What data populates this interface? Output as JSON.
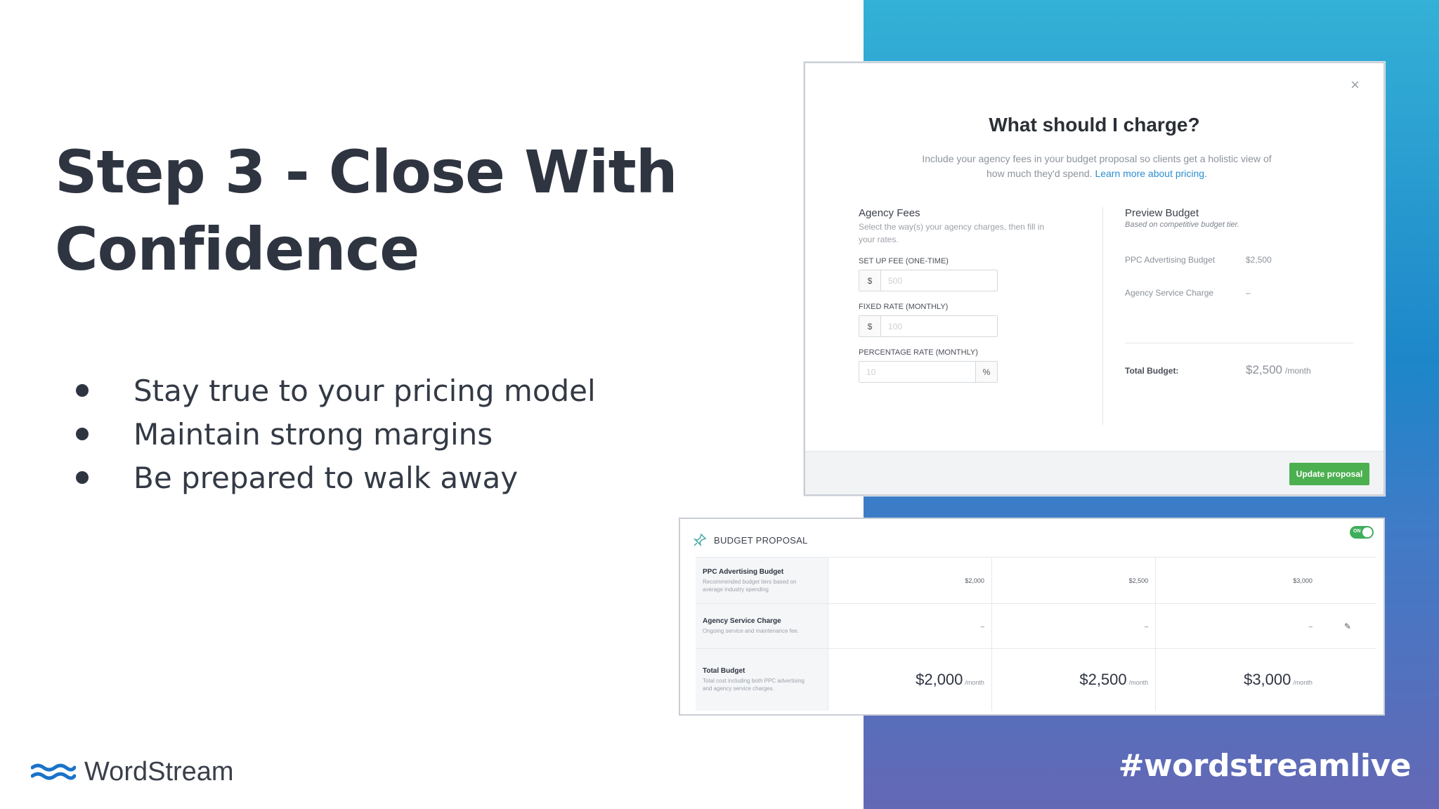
{
  "slide": {
    "title_line1": "Step 3 - Close With",
    "title_line2": "Confidence",
    "bullets": [
      "Stay true to your pricing model",
      "Maintain strong margins",
      "Be prepared to walk away"
    ],
    "brand_name": "WordStream",
    "hashtag": "#wordstreamlive",
    "colors": {
      "accent_gradient_top": "#34b1d6",
      "accent_gradient_bottom": "#6468b5",
      "brand_blue": "#1a73c8",
      "button_green": "#4caf50"
    }
  },
  "modal": {
    "close_icon": "×",
    "title": "What should I charge?",
    "subtitle": "Include your agency fees in your budget proposal so clients get a holistic view of how much they'd spend.",
    "subtitle_link": "Learn more about pricing.",
    "agency_fees": {
      "title": "Agency Fees",
      "description": "Select the way(s) your agency charges, then fill in your rates.",
      "setup_label": "SET UP FEE (ONE-TIME)",
      "setup_prefix": "$",
      "setup_placeholder": "500",
      "fixed_label": "FIXED RATE (MONTHLY)",
      "fixed_prefix": "$",
      "fixed_placeholder": "100",
      "percent_label": "PERCENTAGE RATE (MONTHLY)",
      "percent_placeholder": "10",
      "percent_suffix": "%"
    },
    "preview": {
      "title": "Preview Budget",
      "description": "Based on competitive budget tier.",
      "ppc_label": "PPC Advertising Budget",
      "ppc_value": "$2,500",
      "service_label": "Agency Service Charge",
      "service_value": "–",
      "total_label": "Total Budget:",
      "total_value": "$2,500",
      "total_unit": "/month"
    },
    "update_button": "Update proposal"
  },
  "proposal": {
    "title": "BUDGET PROPOSAL",
    "toggle_label": "ON",
    "rows": {
      "ppc": {
        "title": "PPC Advertising Budget",
        "desc": "Recommended budget tiers based on average industry spending",
        "values": [
          "$2,000",
          "$2,500",
          "$3,000"
        ]
      },
      "service": {
        "title": "Agency Service Charge",
        "desc": "Ongoing service and maintenance fee.",
        "values": [
          "–",
          "–",
          "–"
        ]
      },
      "total": {
        "title": "Total Budget",
        "desc": "Total cost including both PPC advertising and agency service charges.",
        "values": [
          "$2,000",
          "$2,500",
          "$3,000"
        ],
        "unit": "/month"
      }
    }
  }
}
